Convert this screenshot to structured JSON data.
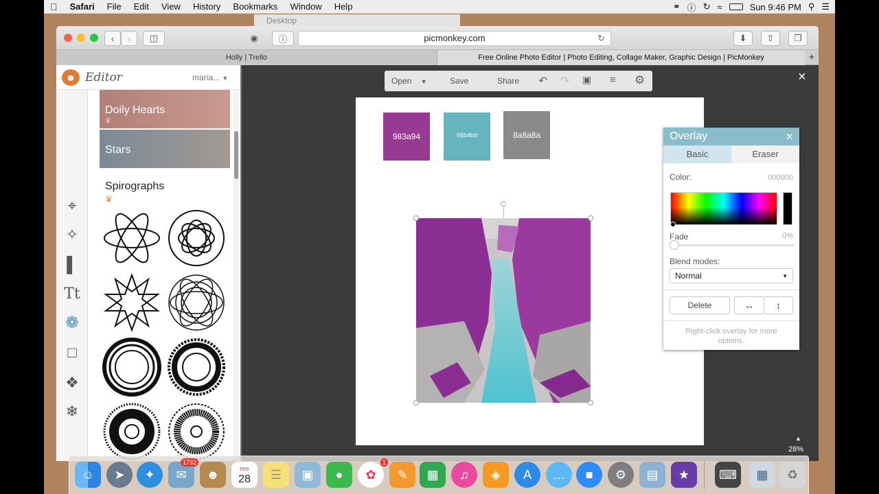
{
  "menubar": {
    "apple": "",
    "app_name": "Safari",
    "items": [
      "File",
      "Edit",
      "View",
      "History",
      "Bookmarks",
      "Window",
      "Help"
    ],
    "clock": "Sun 9:46 PM"
  },
  "browser": {
    "background_window_title": "Desktop",
    "url": "picmonkey.com",
    "tabs": [
      {
        "label": "Holly | Trello"
      },
      {
        "label": "Free Online Photo Editor | Photo Editing, Collage Maker, Graphic Design | PicMonkey"
      }
    ],
    "new_tab": "+"
  },
  "editor": {
    "title": "Editor",
    "user": "maria...",
    "banners": [
      {
        "label": "Doily Hearts"
      },
      {
        "label": "Stars"
      }
    ],
    "section_title": "Spirographs",
    "crown": "♛"
  },
  "photo_toolbar": {
    "open": "Open",
    "save": "Save",
    "share": "Share"
  },
  "close_glyph": "×",
  "canvas": {
    "swatches": [
      {
        "label": "983a94",
        "color": "#983a94"
      },
      {
        "label": "66b4bd",
        "color": "#66b4bd"
      },
      {
        "label": "8a8a8a",
        "color": "#8a8a8a"
      }
    ]
  },
  "overlay_panel": {
    "title": "Overlay",
    "close": "×",
    "tabs": [
      "Basic",
      "Eraser"
    ],
    "color_label": "Color:",
    "color_value": "000000",
    "fade_label": "Fade",
    "fade_value": "0%",
    "fade_fraction": 0,
    "blend_label": "Blend modes:",
    "blend_value": "Normal",
    "delete_label": "Delete",
    "hint": "Right-click overlay for more options."
  },
  "zoom": "28%",
  "dock": {
    "badges": {
      "mail": "1732",
      "photos": "1"
    },
    "calendar_month": "FEB",
    "calendar_day": "28"
  },
  "colors": {
    "overlay_header": "#8bbccc",
    "stage": "#3b3b3b",
    "accent_purple": "#983a94",
    "accent_teal": "#66b4bd"
  }
}
